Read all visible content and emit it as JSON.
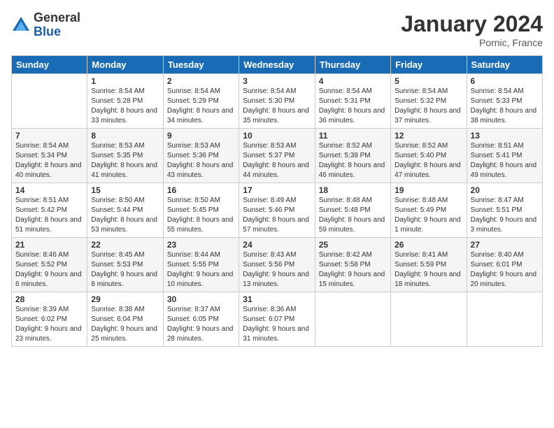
{
  "logo": {
    "general": "General",
    "blue": "Blue"
  },
  "title": "January 2024",
  "location": "Pornic, France",
  "days_header": [
    "Sunday",
    "Monday",
    "Tuesday",
    "Wednesday",
    "Thursday",
    "Friday",
    "Saturday"
  ],
  "weeks": [
    [
      {
        "day": "",
        "sunrise": "",
        "sunset": "",
        "daylight": ""
      },
      {
        "day": "1",
        "sunrise": "Sunrise: 8:54 AM",
        "sunset": "Sunset: 5:28 PM",
        "daylight": "Daylight: 8 hours and 33 minutes."
      },
      {
        "day": "2",
        "sunrise": "Sunrise: 8:54 AM",
        "sunset": "Sunset: 5:29 PM",
        "daylight": "Daylight: 8 hours and 34 minutes."
      },
      {
        "day": "3",
        "sunrise": "Sunrise: 8:54 AM",
        "sunset": "Sunset: 5:30 PM",
        "daylight": "Daylight: 8 hours and 35 minutes."
      },
      {
        "day": "4",
        "sunrise": "Sunrise: 8:54 AM",
        "sunset": "Sunset: 5:31 PM",
        "daylight": "Daylight: 8 hours and 36 minutes."
      },
      {
        "day": "5",
        "sunrise": "Sunrise: 8:54 AM",
        "sunset": "Sunset: 5:32 PM",
        "daylight": "Daylight: 8 hours and 37 minutes."
      },
      {
        "day": "6",
        "sunrise": "Sunrise: 8:54 AM",
        "sunset": "Sunset: 5:33 PM",
        "daylight": "Daylight: 8 hours and 38 minutes."
      }
    ],
    [
      {
        "day": "7",
        "sunrise": "Sunrise: 8:54 AM",
        "sunset": "Sunset: 5:34 PM",
        "daylight": "Daylight: 8 hours and 40 minutes."
      },
      {
        "day": "8",
        "sunrise": "Sunrise: 8:53 AM",
        "sunset": "Sunset: 5:35 PM",
        "daylight": "Daylight: 8 hours and 41 minutes."
      },
      {
        "day": "9",
        "sunrise": "Sunrise: 8:53 AM",
        "sunset": "Sunset: 5:36 PM",
        "daylight": "Daylight: 8 hours and 43 minutes."
      },
      {
        "day": "10",
        "sunrise": "Sunrise: 8:53 AM",
        "sunset": "Sunset: 5:37 PM",
        "daylight": "Daylight: 8 hours and 44 minutes."
      },
      {
        "day": "11",
        "sunrise": "Sunrise: 8:52 AM",
        "sunset": "Sunset: 5:39 PM",
        "daylight": "Daylight: 8 hours and 46 minutes."
      },
      {
        "day": "12",
        "sunrise": "Sunrise: 8:52 AM",
        "sunset": "Sunset: 5:40 PM",
        "daylight": "Daylight: 8 hours and 47 minutes."
      },
      {
        "day": "13",
        "sunrise": "Sunrise: 8:51 AM",
        "sunset": "Sunset: 5:41 PM",
        "daylight": "Daylight: 8 hours and 49 minutes."
      }
    ],
    [
      {
        "day": "14",
        "sunrise": "Sunrise: 8:51 AM",
        "sunset": "Sunset: 5:42 PM",
        "daylight": "Daylight: 8 hours and 51 minutes."
      },
      {
        "day": "15",
        "sunrise": "Sunrise: 8:50 AM",
        "sunset": "Sunset: 5:44 PM",
        "daylight": "Daylight: 8 hours and 53 minutes."
      },
      {
        "day": "16",
        "sunrise": "Sunrise: 8:50 AM",
        "sunset": "Sunset: 5:45 PM",
        "daylight": "Daylight: 8 hours and 55 minutes."
      },
      {
        "day": "17",
        "sunrise": "Sunrise: 8:49 AM",
        "sunset": "Sunset: 5:46 PM",
        "daylight": "Daylight: 8 hours and 57 minutes."
      },
      {
        "day": "18",
        "sunrise": "Sunrise: 8:48 AM",
        "sunset": "Sunset: 5:48 PM",
        "daylight": "Daylight: 8 hours and 59 minutes."
      },
      {
        "day": "19",
        "sunrise": "Sunrise: 8:48 AM",
        "sunset": "Sunset: 5:49 PM",
        "daylight": "Daylight: 9 hours and 1 minute."
      },
      {
        "day": "20",
        "sunrise": "Sunrise: 8:47 AM",
        "sunset": "Sunset: 5:51 PM",
        "daylight": "Daylight: 9 hours and 3 minutes."
      }
    ],
    [
      {
        "day": "21",
        "sunrise": "Sunrise: 8:46 AM",
        "sunset": "Sunset: 5:52 PM",
        "daylight": "Daylight: 9 hours and 6 minutes."
      },
      {
        "day": "22",
        "sunrise": "Sunrise: 8:45 AM",
        "sunset": "Sunset: 5:53 PM",
        "daylight": "Daylight: 9 hours and 8 minutes."
      },
      {
        "day": "23",
        "sunrise": "Sunrise: 8:44 AM",
        "sunset": "Sunset: 5:55 PM",
        "daylight": "Daylight: 9 hours and 10 minutes."
      },
      {
        "day": "24",
        "sunrise": "Sunrise: 8:43 AM",
        "sunset": "Sunset: 5:56 PM",
        "daylight": "Daylight: 9 hours and 13 minutes."
      },
      {
        "day": "25",
        "sunrise": "Sunrise: 8:42 AM",
        "sunset": "Sunset: 5:58 PM",
        "daylight": "Daylight: 9 hours and 15 minutes."
      },
      {
        "day": "26",
        "sunrise": "Sunrise: 8:41 AM",
        "sunset": "Sunset: 5:59 PM",
        "daylight": "Daylight: 9 hours and 18 minutes."
      },
      {
        "day": "27",
        "sunrise": "Sunrise: 8:40 AM",
        "sunset": "Sunset: 6:01 PM",
        "daylight": "Daylight: 9 hours and 20 minutes."
      }
    ],
    [
      {
        "day": "28",
        "sunrise": "Sunrise: 8:39 AM",
        "sunset": "Sunset: 6:02 PM",
        "daylight": "Daylight: 9 hours and 23 minutes."
      },
      {
        "day": "29",
        "sunrise": "Sunrise: 8:38 AM",
        "sunset": "Sunset: 6:04 PM",
        "daylight": "Daylight: 9 hours and 25 minutes."
      },
      {
        "day": "30",
        "sunrise": "Sunrise: 8:37 AM",
        "sunset": "Sunset: 6:05 PM",
        "daylight": "Daylight: 9 hours and 28 minutes."
      },
      {
        "day": "31",
        "sunrise": "Sunrise: 8:36 AM",
        "sunset": "Sunset: 6:07 PM",
        "daylight": "Daylight: 9 hours and 31 minutes."
      },
      {
        "day": "",
        "sunrise": "",
        "sunset": "",
        "daylight": ""
      },
      {
        "day": "",
        "sunrise": "",
        "sunset": "",
        "daylight": ""
      },
      {
        "day": "",
        "sunrise": "",
        "sunset": "",
        "daylight": ""
      }
    ]
  ]
}
